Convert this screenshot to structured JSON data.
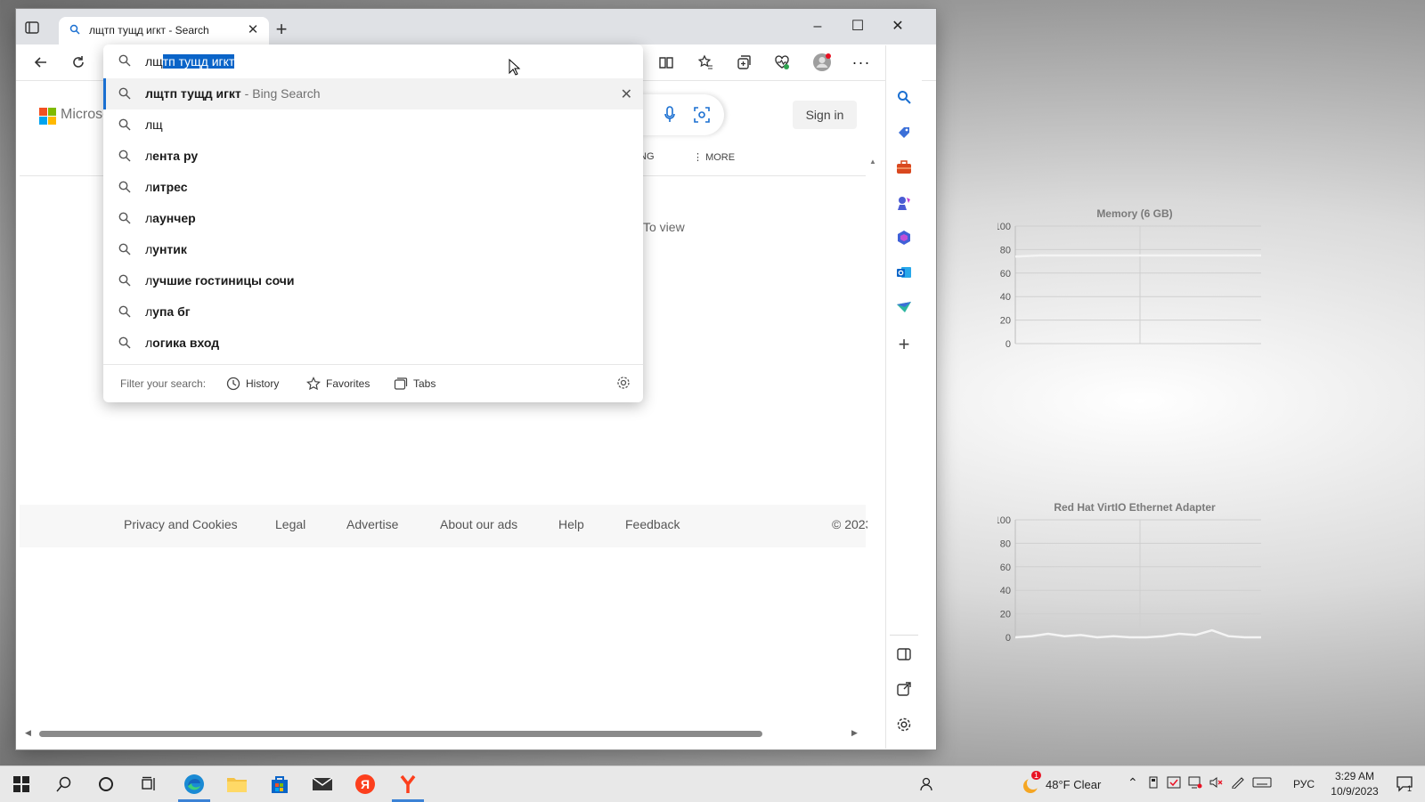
{
  "desktop": {
    "charts": [
      {
        "title": "Memory (6 GB)",
        "yticks": [
          "100",
          "80",
          "60",
          "40",
          "20",
          "0"
        ]
      },
      {
        "title": "Red Hat VirtIO Ethernet Adapter",
        "yticks": [
          "100",
          "80",
          "60",
          "40",
          "20",
          "0"
        ]
      }
    ]
  },
  "chart_data": [
    {
      "type": "line",
      "title": "Memory (6 GB)",
      "ylim": [
        0,
        100
      ],
      "series": [
        {
          "values": [
            74,
            75,
            75,
            75,
            75,
            75,
            75,
            75,
            75,
            75,
            75
          ]
        }
      ]
    },
    {
      "type": "line",
      "title": "Red Hat VirtIO Ethernet Adapter",
      "ylim": [
        0,
        100
      ],
      "series": [
        {
          "values": [
            0,
            1,
            3,
            1,
            2,
            0,
            1,
            0,
            0,
            1,
            3,
            2,
            6,
            1,
            0,
            0
          ]
        }
      ]
    }
  ],
  "browser": {
    "tab": {
      "title": "лщтп тущд игкт - Search"
    },
    "window_controls": {
      "minimize": "–",
      "maximize": "☐",
      "close": "✕"
    },
    "page": {
      "logo_text": "Microsoft",
      "signin": "Sign in",
      "nav_partial": "NG",
      "nav_more": "MORE",
      "to_view": "To view",
      "footer": [
        "Privacy and Cookies",
        "Legal",
        "Advertise",
        "About our ads",
        "Help",
        "Feedback",
        "© 2023"
      ]
    },
    "omnibox": {
      "typed_prefix": "лщ",
      "typed_selected": "тп тущд игкт",
      "active_suggestion": {
        "bold": "лщтп тущд игкт",
        "hint": " - Bing Search"
      },
      "suggestions": [
        {
          "prefix": "лщ",
          "rest": ""
        },
        {
          "prefix": "л",
          "rest": "ента ру"
        },
        {
          "prefix": "л",
          "rest": "итрес"
        },
        {
          "prefix": "л",
          "rest": "аунчер"
        },
        {
          "prefix": "л",
          "rest": "унтик"
        },
        {
          "prefix": "л",
          "rest": "учшие гостиницы сочи"
        },
        {
          "prefix": "л",
          "rest": "упа бг"
        },
        {
          "prefix": "л",
          "rest": "огика вход"
        }
      ],
      "filter": {
        "label": "Filter your search:",
        "history": "History",
        "favorites": "Favorites",
        "tabs": "Tabs"
      }
    }
  },
  "taskbar": {
    "weather": "48°F  Clear",
    "lang": "РУС",
    "time": "3:29 AM",
    "date": "10/9/2023",
    "weather_badge": "1",
    "notify_count": "1"
  },
  "colors": {
    "accent": "#0a64c8",
    "edge_blue": "#1a6fd1",
    "yandex_red": "#fc3f1d"
  }
}
